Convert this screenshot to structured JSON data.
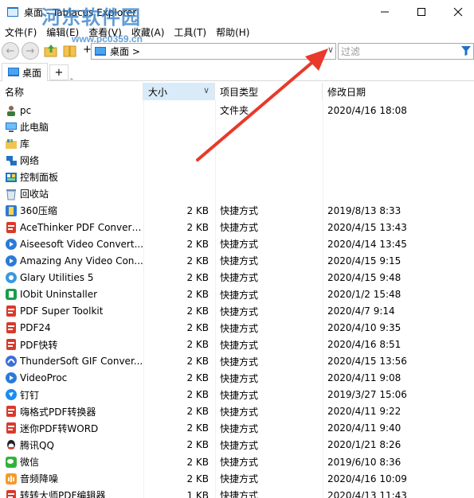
{
  "window": {
    "title": "桌面 - Tablacus Explorer",
    "watermark": "河东软件园",
    "watermark_url": "www.pc0359.cn"
  },
  "menu": [
    "文件(F)",
    "编辑(E)",
    "查看(V)",
    "收藏(A)",
    "工具(T)",
    "帮助(H)"
  ],
  "toolbar": {
    "plus": "+",
    "address": "桌面 >",
    "filter_placeholder": "过滤"
  },
  "tabs": {
    "active": "桌面",
    "add": "+"
  },
  "columns": {
    "name": "名称",
    "size": "大小",
    "type": "项目类型",
    "date": "修改日期"
  },
  "rows": [
    {
      "name": "pc",
      "size": "",
      "type": "文件夹",
      "date": "2020/4/16 18:08",
      "icon": "user-folder-icon"
    },
    {
      "name": "此电脑",
      "size": "",
      "type": "",
      "date": "",
      "icon": "computer-icon"
    },
    {
      "name": "库",
      "size": "",
      "type": "",
      "date": "",
      "icon": "library-icon"
    },
    {
      "name": "网络",
      "size": "",
      "type": "",
      "date": "",
      "icon": "network-icon"
    },
    {
      "name": "控制面板",
      "size": "",
      "type": "",
      "date": "",
      "icon": "control-panel-icon"
    },
    {
      "name": "回收站",
      "size": "",
      "type": "",
      "date": "",
      "icon": "recycle-bin-icon"
    },
    {
      "name": "360压缩",
      "size": "2 KB",
      "type": "快捷方式",
      "date": "2019/8/13 8:33",
      "icon": "archive-app-icon"
    },
    {
      "name": "AceThinker PDF Convert...",
      "size": "2 KB",
      "type": "快捷方式",
      "date": "2020/4/15 13:43",
      "icon": "pdf-app-icon"
    },
    {
      "name": "Aiseesoft Video Convert...",
      "size": "2 KB",
      "type": "快捷方式",
      "date": "2020/4/14 13:45",
      "icon": "video-app-icon"
    },
    {
      "name": "Amazing Any Video Con...",
      "size": "2 KB",
      "type": "快捷方式",
      "date": "2020/4/15 9:15",
      "icon": "video-app-icon"
    },
    {
      "name": "Glary Utilities 5",
      "size": "2 KB",
      "type": "快捷方式",
      "date": "2020/4/15 9:48",
      "icon": "utility-app-icon"
    },
    {
      "name": "IObit Uninstaller",
      "size": "2 KB",
      "type": "快捷方式",
      "date": "2020/1/2 15:48",
      "icon": "uninstaller-app-icon"
    },
    {
      "name": "PDF Super Toolkit",
      "size": "2 KB",
      "type": "快捷方式",
      "date": "2020/4/7 9:14",
      "icon": "pdf-app-icon"
    },
    {
      "name": "PDF24",
      "size": "2 KB",
      "type": "快捷方式",
      "date": "2020/4/10 9:35",
      "icon": "pdf-app-icon"
    },
    {
      "name": "PDF快转",
      "size": "2 KB",
      "type": "快捷方式",
      "date": "2020/4/16 8:51",
      "icon": "pdf-app-icon"
    },
    {
      "name": "ThunderSoft GIF Conver...",
      "size": "2 KB",
      "type": "快捷方式",
      "date": "2020/4/15 13:56",
      "icon": "gif-app-icon"
    },
    {
      "name": "VideoProc",
      "size": "2 KB",
      "type": "快捷方式",
      "date": "2020/4/11 9:08",
      "icon": "video-app-icon"
    },
    {
      "name": "钉钉",
      "size": "2 KB",
      "type": "快捷方式",
      "date": "2019/3/27 15:06",
      "icon": "dingtalk-app-icon"
    },
    {
      "name": "嗨格式PDF转换器",
      "size": "2 KB",
      "type": "快捷方式",
      "date": "2020/4/11 9:22",
      "icon": "pdf-app-icon"
    },
    {
      "name": "迷你PDF转WORD",
      "size": "2 KB",
      "type": "快捷方式",
      "date": "2020/4/11 9:40",
      "icon": "pdf-app-icon"
    },
    {
      "name": "腾讯QQ",
      "size": "2 KB",
      "type": "快捷方式",
      "date": "2020/1/21 8:26",
      "icon": "qq-app-icon"
    },
    {
      "name": "微信",
      "size": "2 KB",
      "type": "快捷方式",
      "date": "2019/6/10 8:36",
      "icon": "wechat-app-icon"
    },
    {
      "name": "音频降噪",
      "size": "2 KB",
      "type": "快捷方式",
      "date": "2020/4/16 10:09",
      "icon": "audio-app-icon"
    },
    {
      "name": "转转大师PDF编辑器",
      "size": "1 KB",
      "type": "快捷方式",
      "date": "2020/4/13 11:43",
      "icon": "pdf-app-icon"
    }
  ],
  "colors": {
    "sorted_header": "#d9ebf9",
    "arrow": "#e8392b",
    "watermark": "#2a7ac8"
  }
}
